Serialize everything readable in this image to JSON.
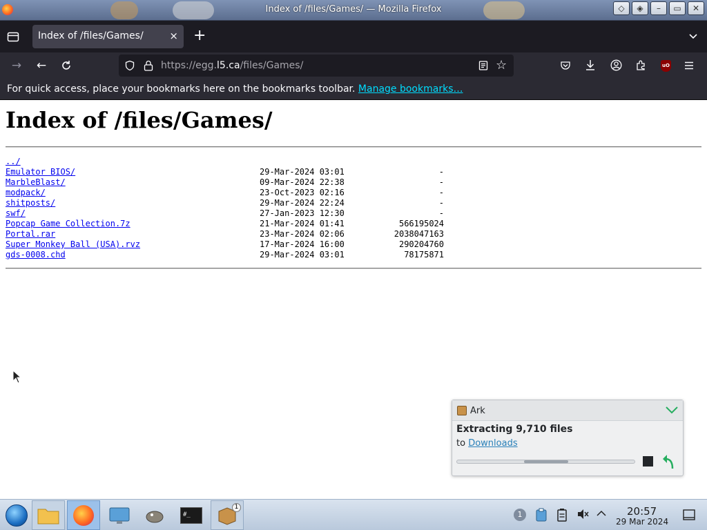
{
  "window": {
    "title": "Index of /files/Games/ — Mozilla Firefox"
  },
  "tabs": [
    {
      "label": "Index of /files/Games/",
      "close": "×"
    }
  ],
  "tabstrip": {
    "new_tab": "+"
  },
  "navbar": {
    "url_prefix": "https://egg.",
    "url_host": "l5.ca",
    "url_path": "/files/Games/"
  },
  "bookmarks": {
    "message": "For quick access, place your bookmarks here on the bookmarks toolbar.",
    "link": "Manage bookmarks…"
  },
  "page": {
    "heading": "Index of /files/Games/",
    "parent_link": "../",
    "entries": [
      {
        "name": "Emulator BIOS/",
        "date": "29-Mar-2024 03:01",
        "size": "-"
      },
      {
        "name": "MarbleBlast/",
        "date": "09-Mar-2024 22:38",
        "size": "-"
      },
      {
        "name": "modpack/",
        "date": "23-Oct-2023 02:16",
        "size": "-"
      },
      {
        "name": "shitposts/",
        "date": "29-Mar-2024 22:24",
        "size": "-"
      },
      {
        "name": "swf/",
        "date": "27-Jan-2023 12:30",
        "size": "-"
      },
      {
        "name": "Popcap Game Collection.7z",
        "date": "21-Mar-2024 01:41",
        "size": "566195024"
      },
      {
        "name": "Portal.rar",
        "date": "23-Mar-2024 02:06",
        "size": "2038047163"
      },
      {
        "name": "Super Monkey Ball (USA).rvz",
        "date": "17-Mar-2024 16:00",
        "size": "290204760"
      },
      {
        "name": "gds-0008.chd",
        "date": "29-Mar-2024 03:01",
        "size": "78175871"
      }
    ]
  },
  "notification": {
    "app": "Ark",
    "message": "Extracting 9,710 files",
    "to_prefix": "to",
    "destination": "Downloads",
    "progress": 0.5
  },
  "taskbar": {
    "apps": [
      "start-menu",
      "file-manager",
      "firefox",
      "system-settings",
      "gimp",
      "terminal",
      "ark"
    ],
    "ark_badge": "1",
    "tray_badge": "1",
    "clock_time": "20:57",
    "clock_date": "29 Mar 2024"
  },
  "colors": {
    "link": "#0000ee",
    "toolbar_bg": "#2b2a33",
    "tab_bg": "#42414d",
    "bookmark_link": "#00ddff",
    "notification_link": "#2980b9"
  }
}
